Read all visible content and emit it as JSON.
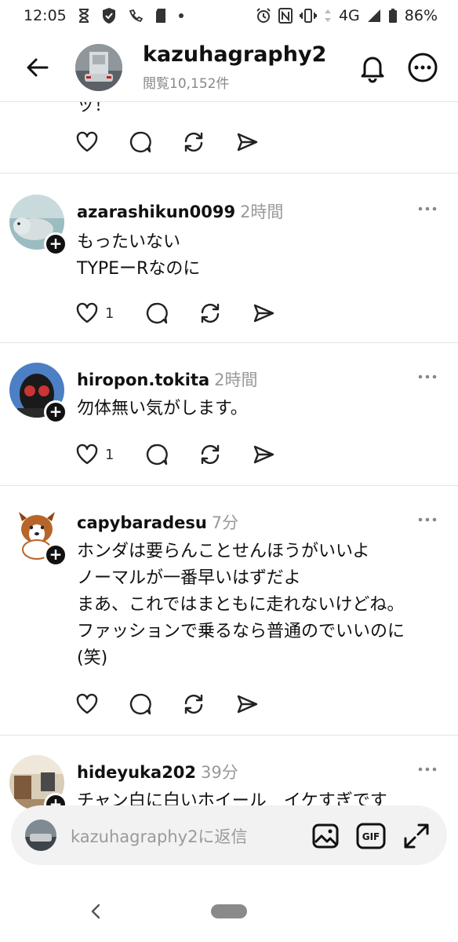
{
  "status_bar": {
    "time": "12:05",
    "network": "4G",
    "battery": "86%"
  },
  "header": {
    "title": "kazuhagraphy2",
    "views": "閲覧10,152件"
  },
  "partial_post": {
    "text_fragment": "ッ！"
  },
  "posts": [
    {
      "username": "azarashikun0099",
      "time": "2時間",
      "text": "もったいない\nTYPEーRなのに",
      "likes": "1",
      "avatar_icon": "seal-photo"
    },
    {
      "username": "hiropon.tokita",
      "time": "2時間",
      "text": "勿体無い気がします。",
      "likes": "1",
      "avatar_icon": "helmet-photo"
    },
    {
      "username": "capybaradesu",
      "time": "7分",
      "text": "ホンダは要らんことせんほうがいいよ\nノーマルが一番早いはずだよ\nまあ、これではまともに走れないけどね。\nファッションで乗るなら普通のでいいのに\n(笑)",
      "likes": "",
      "avatar_icon": "dog-illustration"
    },
    {
      "username": "hideyuka202",
      "time": "39分",
      "text": "チャン白に白いホイール　イケすぎです",
      "likes": "",
      "avatar_icon": "room-photo"
    }
  ],
  "composer": {
    "placeholder": "kazuhagraphy2に返信",
    "gif_label": "GIF"
  },
  "colors": {
    "text": "#111111",
    "muted": "#999999",
    "divider": "#e4e4e4",
    "composer_bg": "#f2f2f2"
  }
}
